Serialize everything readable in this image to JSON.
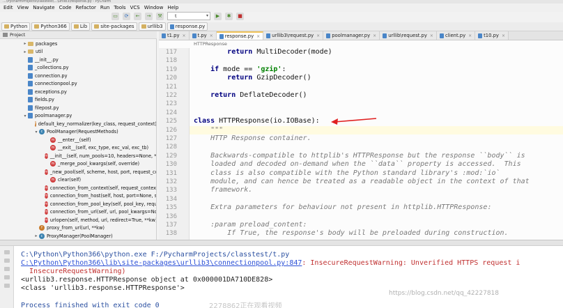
{
  "titlebar": "...\\PycharmProjects\\classtest\\...\\urllib3\\response.py - PyCharm",
  "menu": [
    "Edit",
    "View",
    "Navigate",
    "Code",
    "Refactor",
    "Run",
    "Tools",
    "VCS",
    "Window",
    "Help"
  ],
  "toolbar": {
    "run_config": "t"
  },
  "breadcrumbs": [
    "Python",
    "Python366",
    "Lib",
    "site-packages",
    "urllib3",
    "response.py"
  ],
  "sidebar": {
    "header": "Project",
    "items": [
      {
        "label": "packages",
        "type": "folder",
        "indent": 1
      },
      {
        "label": "util",
        "type": "folder",
        "indent": 1
      },
      {
        "label": "__init__.py",
        "type": "file",
        "indent": 1
      },
      {
        "label": "_collections.py",
        "type": "file",
        "indent": 1
      },
      {
        "label": "connection.py",
        "type": "file",
        "indent": 1
      },
      {
        "label": "connectionpool.py",
        "type": "file",
        "indent": 1
      },
      {
        "label": "exceptions.py",
        "type": "file",
        "indent": 1
      },
      {
        "label": "fields.py",
        "type": "file",
        "indent": 1
      },
      {
        "label": "filepost.py",
        "type": "file",
        "indent": 1
      },
      {
        "label": "poolmanager.py",
        "type": "file",
        "indent": 1,
        "open": true
      },
      {
        "label": "default_key_normalizer(key_class, request_context)",
        "type": "func",
        "indent": 2
      },
      {
        "label": "PoolManager(RequestMethods)",
        "type": "class",
        "indent": 2,
        "open": true
      },
      {
        "label": "__enter__(self)",
        "type": "method",
        "indent": 3
      },
      {
        "label": "__exit__(self, exc_type, exc_val, exc_tb)",
        "type": "method",
        "indent": 3
      },
      {
        "label": "__init__(self, num_pools=10, headers=None, **co",
        "type": "method",
        "indent": 3
      },
      {
        "label": "_merge_pool_kwargs(self, override)",
        "type": "method",
        "indent": 3
      },
      {
        "label": "_new_pool(self, scheme, host, port, request_con",
        "type": "method",
        "indent": 3
      },
      {
        "label": "clear(self)",
        "type": "method",
        "indent": 3
      },
      {
        "label": "connection_from_context(self, request_context)",
        "type": "method",
        "indent": 3
      },
      {
        "label": "connection_from_host(self, host, port=None, sch",
        "type": "method",
        "indent": 3
      },
      {
        "label": "connection_from_pool_key(self, pool_key, reque",
        "type": "method",
        "indent": 3
      },
      {
        "label": "connection_from_url(self, url, pool_kwargs=Non",
        "type": "method",
        "indent": 3
      },
      {
        "label": "urlopen(self, method, url, redirect=True, **kw)",
        "type": "method",
        "indent": 3
      },
      {
        "label": "proxy_from_url(url, **kw)",
        "type": "func",
        "indent": 2
      },
      {
        "label": "ProxyManager(PoolManager)",
        "type": "class",
        "indent": 2
      }
    ]
  },
  "tabs": [
    {
      "label": "t1.py",
      "active": false
    },
    {
      "label": "t.py",
      "active": false
    },
    {
      "label": "response.py",
      "active": true
    },
    {
      "label": "urllib3\\request.py",
      "active": false
    },
    {
      "label": "poolmanager.py",
      "active": false
    },
    {
      "label": "urllib\\request.py",
      "active": false
    },
    {
      "label": "client.py",
      "active": false
    },
    {
      "label": "t10.py",
      "active": false
    }
  ],
  "editor": {
    "context": "HTTPResponse",
    "lines": [
      {
        "n": "117",
        "html": "        <span class='kw'>return</span> MultiDecoder(mode)"
      },
      {
        "n": "118",
        "html": ""
      },
      {
        "n": "119",
        "html": "    <span class='kw'>if</span> mode == <span class='st'>'gzip'</span>:"
      },
      {
        "n": "120",
        "html": "        <span class='kw'>return</span> GzipDecoder()"
      },
      {
        "n": "121",
        "html": ""
      },
      {
        "n": "122",
        "html": "    <span class='kw'>return</span> DeflateDecoder()"
      },
      {
        "n": "123",
        "html": ""
      },
      {
        "n": "124",
        "html": ""
      },
      {
        "n": "125",
        "html": "<span class='kw'>class</span> HTTPResponse(io.IOBase):"
      },
      {
        "n": "126",
        "html": "    <span class='doc'>\"\"\"</span>"
      },
      {
        "n": "127",
        "html": "    <span class='doc'>HTTP Response container.</span>"
      },
      {
        "n": "128",
        "html": ""
      },
      {
        "n": "129",
        "html": "    <span class='doc'>Backwards-compatible to httplib's HTTPResponse but the response ``body`` is</span>"
      },
      {
        "n": "130",
        "html": "    <span class='doc'>loaded and decoded on-demand when the ``data`` property is accessed.  This</span>"
      },
      {
        "n": "131",
        "html": "    <span class='doc'>class is also compatible with the Python standard library's :mod:`io`</span>"
      },
      {
        "n": "132",
        "html": "    <span class='doc'>module, and can hence be treated as a readable object in the context of that</span>"
      },
      {
        "n": "133",
        "html": "    <span class='doc'>framework.</span>"
      },
      {
        "n": "134",
        "html": ""
      },
      {
        "n": "135",
        "html": "    <span class='doc'>Extra parameters for behaviour not present in httplib.HTTPResponse:</span>"
      },
      {
        "n": "136",
        "html": ""
      },
      {
        "n": "137",
        "html": "    <span class='doc'>:param preload_content:</span>"
      },
      {
        "n": "138",
        "html": "        <span class='doc'>If True, the response's body will be preloaded during construction.</span>"
      }
    ]
  },
  "console": {
    "lines": [
      {
        "html": "C:\\Python\\Python366\\python.exe F:/PycharmProjects/classtest/t.py",
        "cls": "fin"
      },
      {
        "html": "<span class='link'>C:\\Python\\Python366\\lib\\site-packages\\urllib3\\connectionpool.py:847</span><span class='err'>: InsecureRequestWarning: Unverified HTTPS request i</span>",
        "cls": ""
      },
      {
        "html": "  InsecureRequestWarning)",
        "cls": "err"
      },
      {
        "html": "&lt;urllib3.response.HTTPResponse object at 0x000001DA710DE828&gt;",
        "cls": ""
      },
      {
        "html": "&lt;class 'urllib3.response.HTTPResponse'&gt;",
        "cls": ""
      },
      {
        "html": "",
        "cls": ""
      },
      {
        "html": "Process finished with exit code 0",
        "cls": "fin"
      }
    ]
  },
  "watermark": "https://blog.csdn.net/qq_42227818",
  "watermark2": "2278862正在观看视频"
}
